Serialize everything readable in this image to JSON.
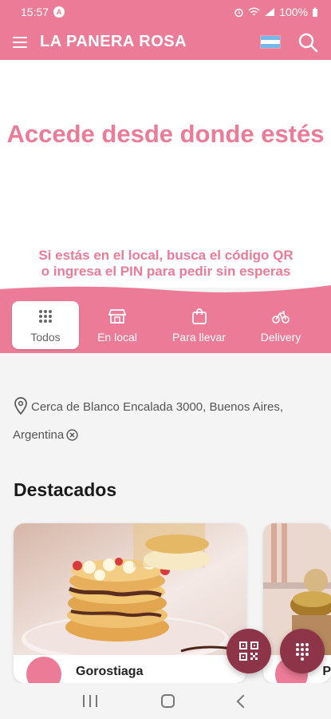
{
  "status_bar": {
    "time": "15:57",
    "battery": "100%"
  },
  "app_bar": {
    "title": "LA PANERA ROSA",
    "flag_country": "argentina-flag"
  },
  "hero": {
    "title": "Accede desde donde estés",
    "subtitle": "Si estás en el local, busca el código QR o ingresa el PIN para pedir sin esperas"
  },
  "tabs": [
    {
      "label": "Todos",
      "icon": "grid-icon",
      "active": true
    },
    {
      "label": "En local",
      "icon": "store-icon"
    },
    {
      "label": "Para llevar",
      "icon": "bag-icon"
    },
    {
      "label": "Delivery",
      "icon": "bicycle-icon"
    }
  ],
  "location": {
    "text": "Cerca de Blanco Encalada 3000, Buenos Aires, Argentina"
  },
  "section": {
    "title": "Destacados"
  },
  "cards": [
    {
      "title": "Gorostiaga"
    },
    {
      "title": "P"
    }
  ],
  "colors": {
    "brand_pink": "#ec7b97",
    "fab": "#8e3448"
  }
}
